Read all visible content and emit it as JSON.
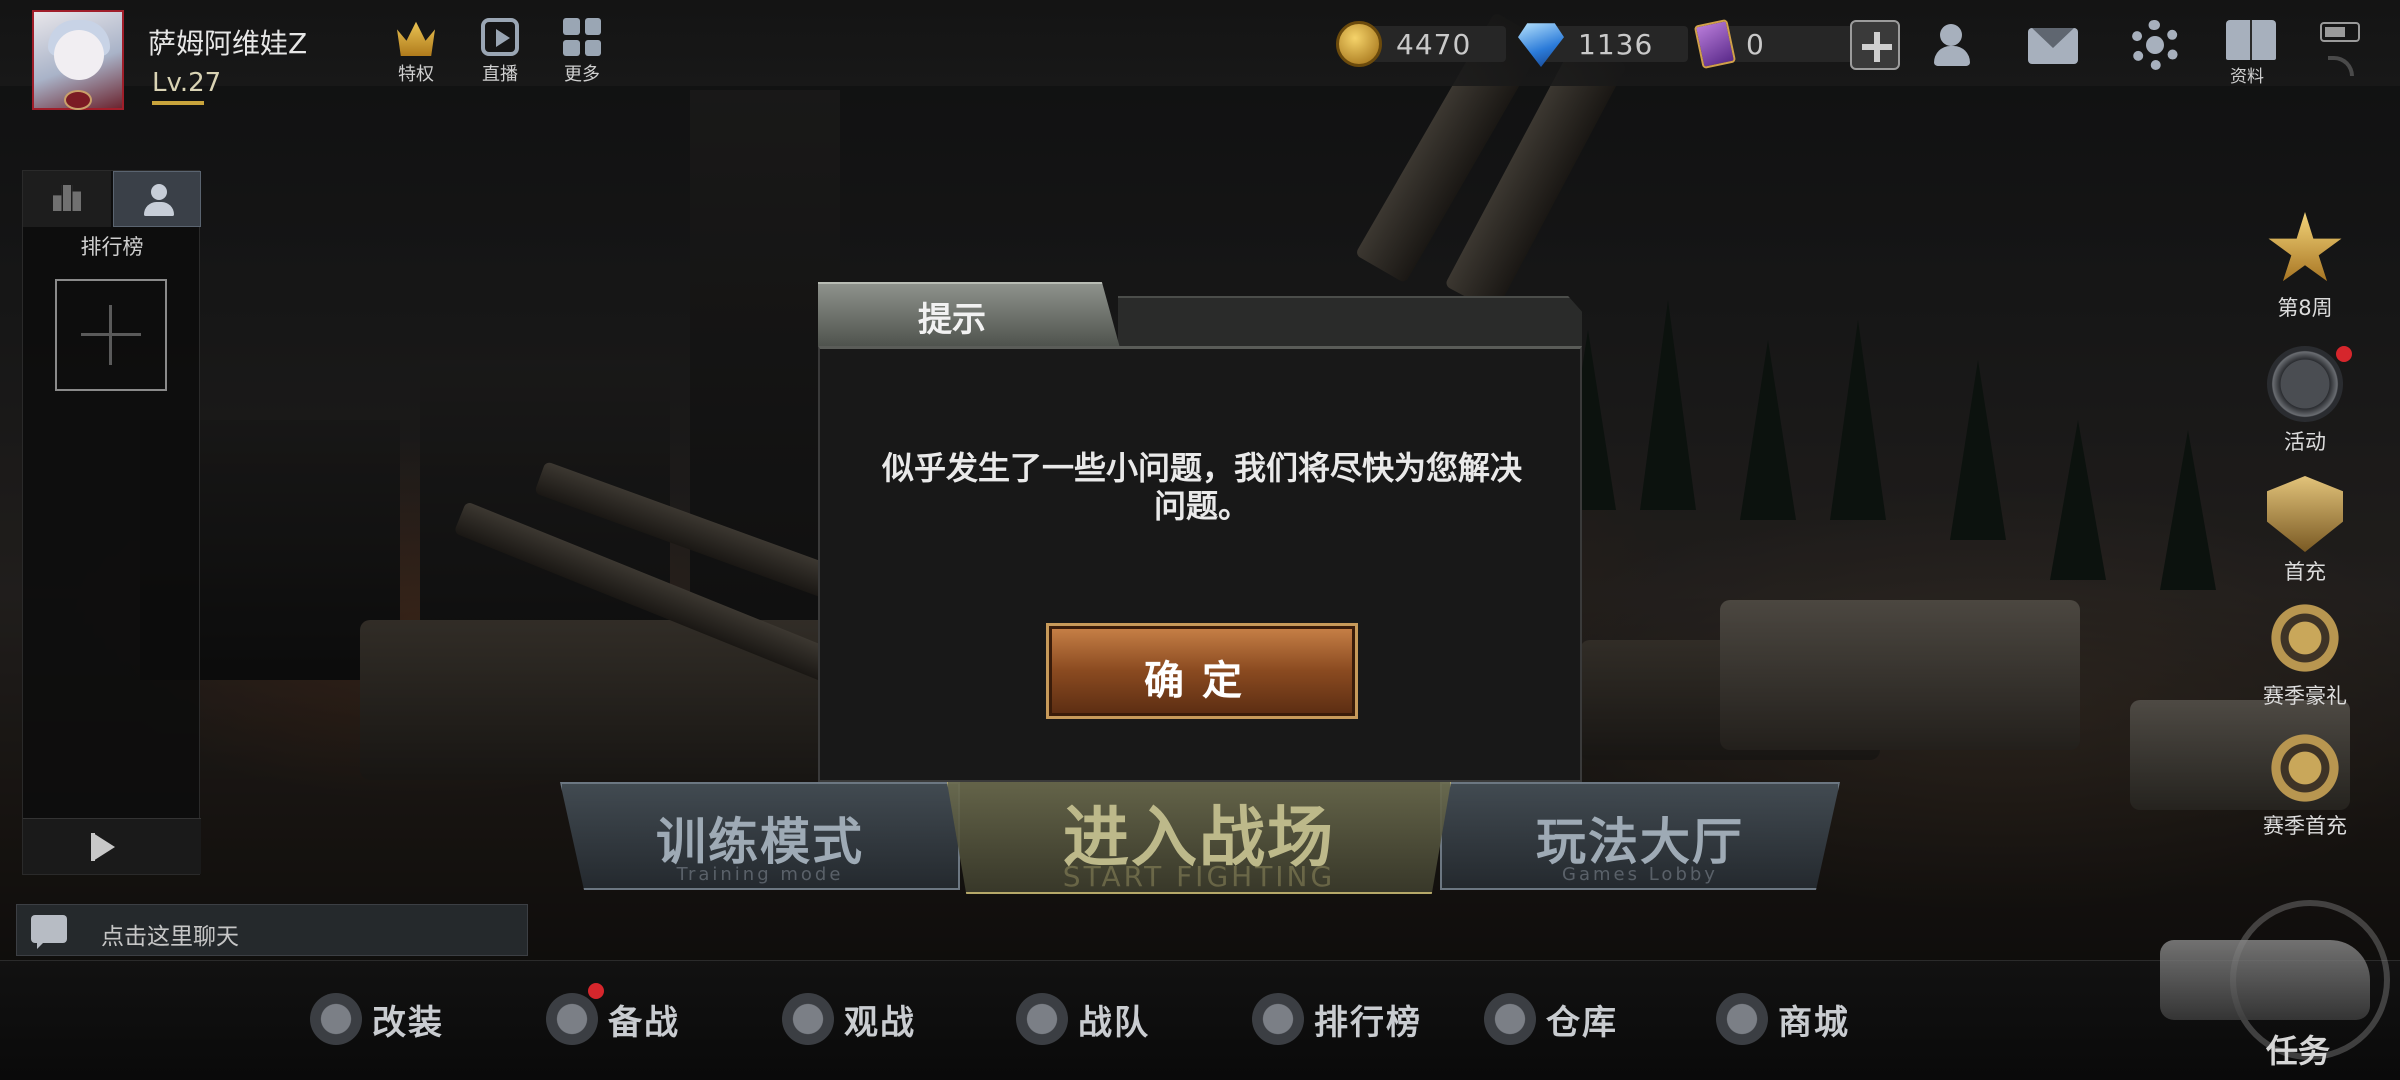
{
  "player": {
    "name": "萨姆阿维娃Z",
    "level": "Lv.27"
  },
  "top_buttons": [
    {
      "label": "特权",
      "icon": "crown-icon"
    },
    {
      "label": "直播",
      "icon": "live-icon"
    },
    {
      "label": "更多",
      "icon": "more-icon"
    }
  ],
  "currencies": {
    "gold": "4470",
    "diamond": "1136",
    "card": "0"
  },
  "top_right": {
    "add_icon": "plus-icon",
    "friends_icon": "friends-icon",
    "mail_icon": "mail-icon",
    "settings_icon": "gear-icon",
    "profile_label": "资料"
  },
  "left_panel": {
    "title": "排行榜"
  },
  "chat": {
    "placeholder": "点击这里聊天"
  },
  "side_events": [
    {
      "label": "第8周",
      "icon": "star-icon",
      "badge": false
    },
    {
      "label": "活动",
      "icon": "activity-icon",
      "badge": true
    },
    {
      "label": "首充",
      "icon": "first-charge-icon",
      "badge": false
    },
    {
      "label": "赛季豪礼",
      "icon": "season-gift-icon",
      "badge": false
    },
    {
      "label": "赛季首充",
      "icon": "season-first-charge-icon",
      "badge": false
    }
  ],
  "modes": {
    "training": {
      "title": "训练模式",
      "subtitle": "Training mode"
    },
    "battle": {
      "title": "进入战场",
      "subtitle": "START FIGHTING"
    },
    "lobby": {
      "title": "玩法大厅",
      "subtitle": "Games Lobby"
    }
  },
  "bottom_nav": [
    {
      "label": "改装",
      "icon": "modify-icon",
      "badge": false
    },
    {
      "label": "备战",
      "icon": "gasmask-icon",
      "badge": true
    },
    {
      "label": "观战",
      "icon": "spectate-icon",
      "badge": false
    },
    {
      "label": "战队",
      "icon": "team-icon",
      "badge": false
    },
    {
      "label": "排行榜",
      "icon": "trophy-icon",
      "badge": false
    },
    {
      "label": "仓库",
      "icon": "warehouse-icon",
      "badge": false
    },
    {
      "label": "商城",
      "icon": "shop-icon",
      "badge": false
    }
  ],
  "task": {
    "label": "任务"
  },
  "dialog": {
    "title": "提示",
    "message": "似乎发生了一些小问题，我们将尽快为您解决问题。",
    "ok_label": "确定"
  },
  "colors": {
    "accent_gold": "#c9a43c",
    "button_orange": "#c98248",
    "badge_red": "#d6262c",
    "player_frame": "#a01e2a"
  }
}
